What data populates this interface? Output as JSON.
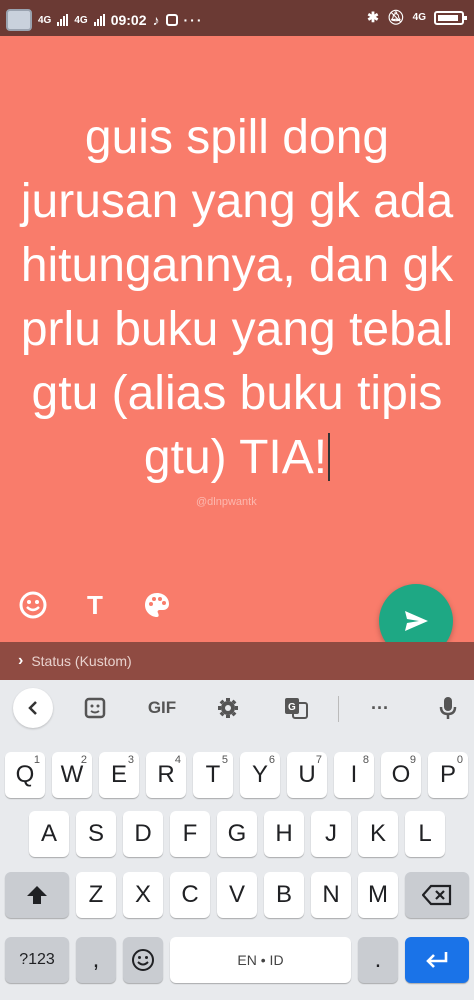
{
  "status_bar": {
    "network_left_1": "4G",
    "network_left_2": "4G",
    "time": "09:02",
    "network_right": "4G",
    "more_dots": "···"
  },
  "editor": {
    "status_text": "guis spill dong jurusan yang gk ada hitungannya, dan gk prlu buku yang tebal gtu (alias buku tipis gtu) TIA!",
    "watermark": "@dlnpwantk",
    "background_color": "#f97c6b",
    "send_color": "#1ea884",
    "tools": [
      "emoji-icon",
      "text-icon",
      "palette-icon"
    ],
    "text_tool_label": "T"
  },
  "audience": {
    "label": "Status (Kustom)"
  },
  "keyboard": {
    "toolbar": {
      "gif_label": "GIF",
      "more_label": "···"
    },
    "row1": [
      {
        "key": "Q",
        "hint": "1"
      },
      {
        "key": "W",
        "hint": "2"
      },
      {
        "key": "E",
        "hint": "3"
      },
      {
        "key": "R",
        "hint": "4"
      },
      {
        "key": "T",
        "hint": "5"
      },
      {
        "key": "Y",
        "hint": "6"
      },
      {
        "key": "U",
        "hint": "7"
      },
      {
        "key": "I",
        "hint": "8"
      },
      {
        "key": "O",
        "hint": "9"
      },
      {
        "key": "P",
        "hint": "0"
      }
    ],
    "row2": [
      "A",
      "S",
      "D",
      "F",
      "G",
      "H",
      "J",
      "K",
      "L"
    ],
    "row3": [
      "Z",
      "X",
      "C",
      "V",
      "B",
      "N",
      "M"
    ],
    "bottom": {
      "symbols_label": "?123",
      "comma_label": ",",
      "space_label": "EN • ID",
      "period_label": "."
    },
    "enter_color": "#1a73e8"
  }
}
